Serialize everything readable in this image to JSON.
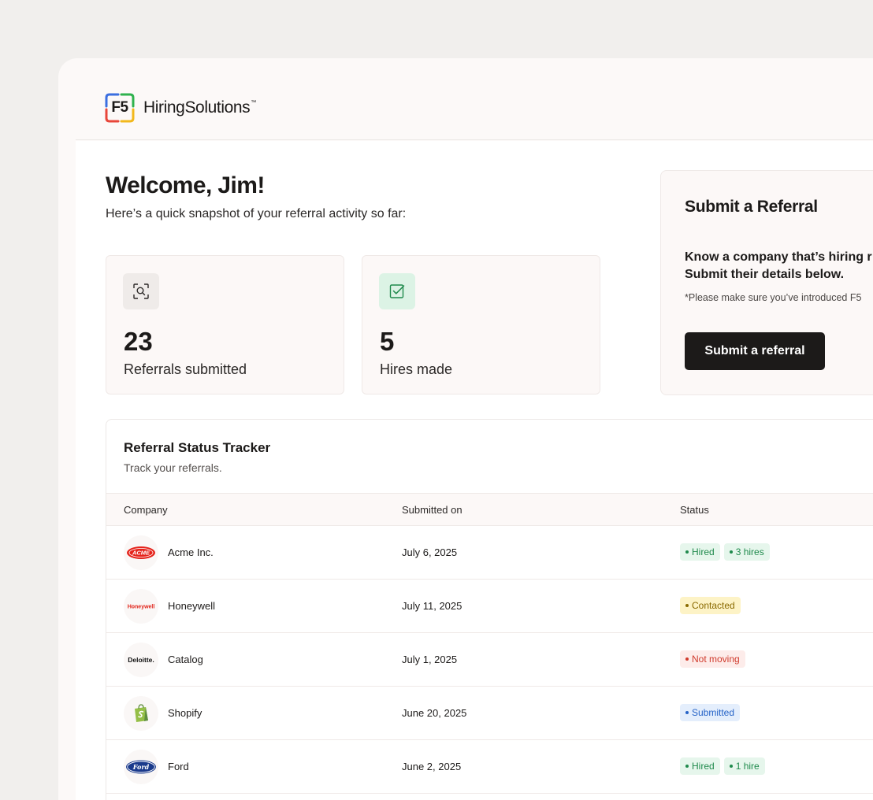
{
  "brand": {
    "logo_mark": "F5",
    "name": "HiringSolutions",
    "trademark": "™"
  },
  "welcome": {
    "title": "Welcome, Jim!",
    "subtitle": "Here’s a quick snapshot of your referral activity so far:"
  },
  "stats": [
    {
      "icon": "search-scan-icon",
      "value": "23",
      "label": "Referrals submitted"
    },
    {
      "icon": "check-square-icon",
      "value": "5",
      "label": "Hires made"
    }
  ],
  "referral": {
    "title": "Submit a Referral",
    "body_line1": "Know a company that’s hiring r",
    "body_line2": "Submit their details below.",
    "note": "*Please make sure you’ve introduced F5",
    "button_label": "Submit a referral"
  },
  "tracker": {
    "title": "Referral Status Tracker",
    "subtitle": "Track your referrals.",
    "columns": {
      "company": "Company",
      "submitted": "Submitted on",
      "status": "Status"
    },
    "rows": [
      {
        "logo": "ACME",
        "company": "Acme Inc.",
        "date": "July 6, 2025",
        "status": "Hired",
        "status_color": "green",
        "extra": "3 hires"
      },
      {
        "logo": "Honeywell",
        "company": "Honeywell",
        "date": "July 11, 2025",
        "status": "Contacted",
        "status_color": "yellow",
        "extra": ""
      },
      {
        "logo": "Deloitte.",
        "company": "Catalog",
        "date": "July 1, 2025",
        "status": "Not moving",
        "status_color": "red",
        "extra": ""
      },
      {
        "logo": "shopify-bag",
        "company": "Shopify",
        "date": "June 20, 2025",
        "status": "Submitted",
        "status_color": "blue",
        "extra": ""
      },
      {
        "logo": "Ford",
        "company": "Ford",
        "date": "June 2, 2025",
        "status": "Hired",
        "status_color": "green",
        "extra": "1 hire"
      }
    ]
  },
  "colors": {
    "page_bg": "#f1efed",
    "window_bg": "#fcf9f8",
    "primary_button": "#1c1a19",
    "hired": "#1f8a4c",
    "contacted": "#8a6a00",
    "not_moving": "#d03a2c",
    "submitted": "#2563c7"
  }
}
